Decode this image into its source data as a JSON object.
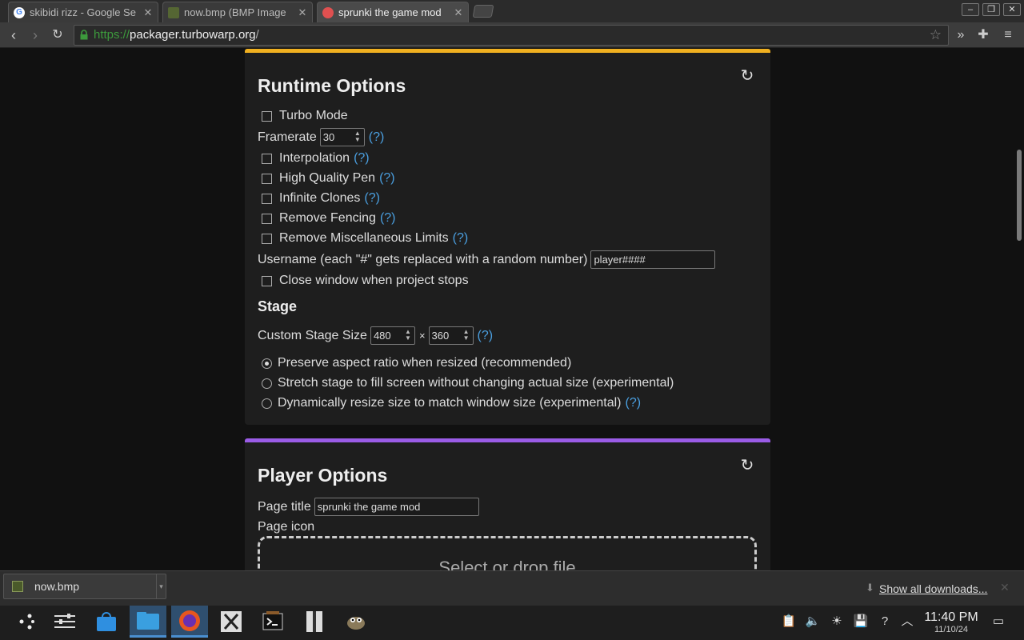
{
  "browser": {
    "tabs": [
      {
        "title": "skibidi rizz - Google Se",
        "close": "✕"
      },
      {
        "title": "now.bmp (BMP Image",
        "close": "✕"
      },
      {
        "title": "sprunki the game mod",
        "close": "✕"
      }
    ],
    "window_controls": {
      "minimize": "–",
      "restore": "❐",
      "close": "✕"
    },
    "address": {
      "scheme": "https://",
      "host": "packager.turbowarp.org",
      "path": "/"
    }
  },
  "runtime": {
    "title": "Runtime Options",
    "turbo": "Turbo Mode",
    "framerate_label": "Framerate",
    "framerate_value": "30",
    "help": "(?)",
    "interpolation": "Interpolation",
    "hq_pen": "High Quality Pen",
    "infinite_clones": "Infinite Clones",
    "remove_fencing": "Remove Fencing",
    "remove_misc": "Remove Miscellaneous Limits",
    "username_label": "Username (each \"#\" gets replaced with a random number)",
    "username_value": "player####",
    "close_window": "Close window when project stops",
    "stage_heading": "Stage",
    "stage_size_label": "Custom Stage Size",
    "stage_width": "480",
    "stage_times": "×",
    "stage_height": "360",
    "preserve": "Preserve aspect ratio when resized (recommended)",
    "stretch": "Stretch stage to fill screen without changing actual size (experimental)",
    "dynamic": "Dynamically resize size to match window size (experimental)"
  },
  "player": {
    "title": "Player Options",
    "page_title_label": "Page title",
    "page_title_value": "sprunki the game mod",
    "page_icon_label": "Page icon",
    "dropzone": "Select or drop file"
  },
  "downloads": {
    "file": "now.bmp",
    "show_all": "Show all downloads..."
  },
  "clock": {
    "time": "11:40 PM",
    "date": "11/10/24"
  },
  "colors": {
    "runtime_accent": "#f0b020",
    "player_accent": "#9a5ce6",
    "link": "#4a9fe0"
  }
}
